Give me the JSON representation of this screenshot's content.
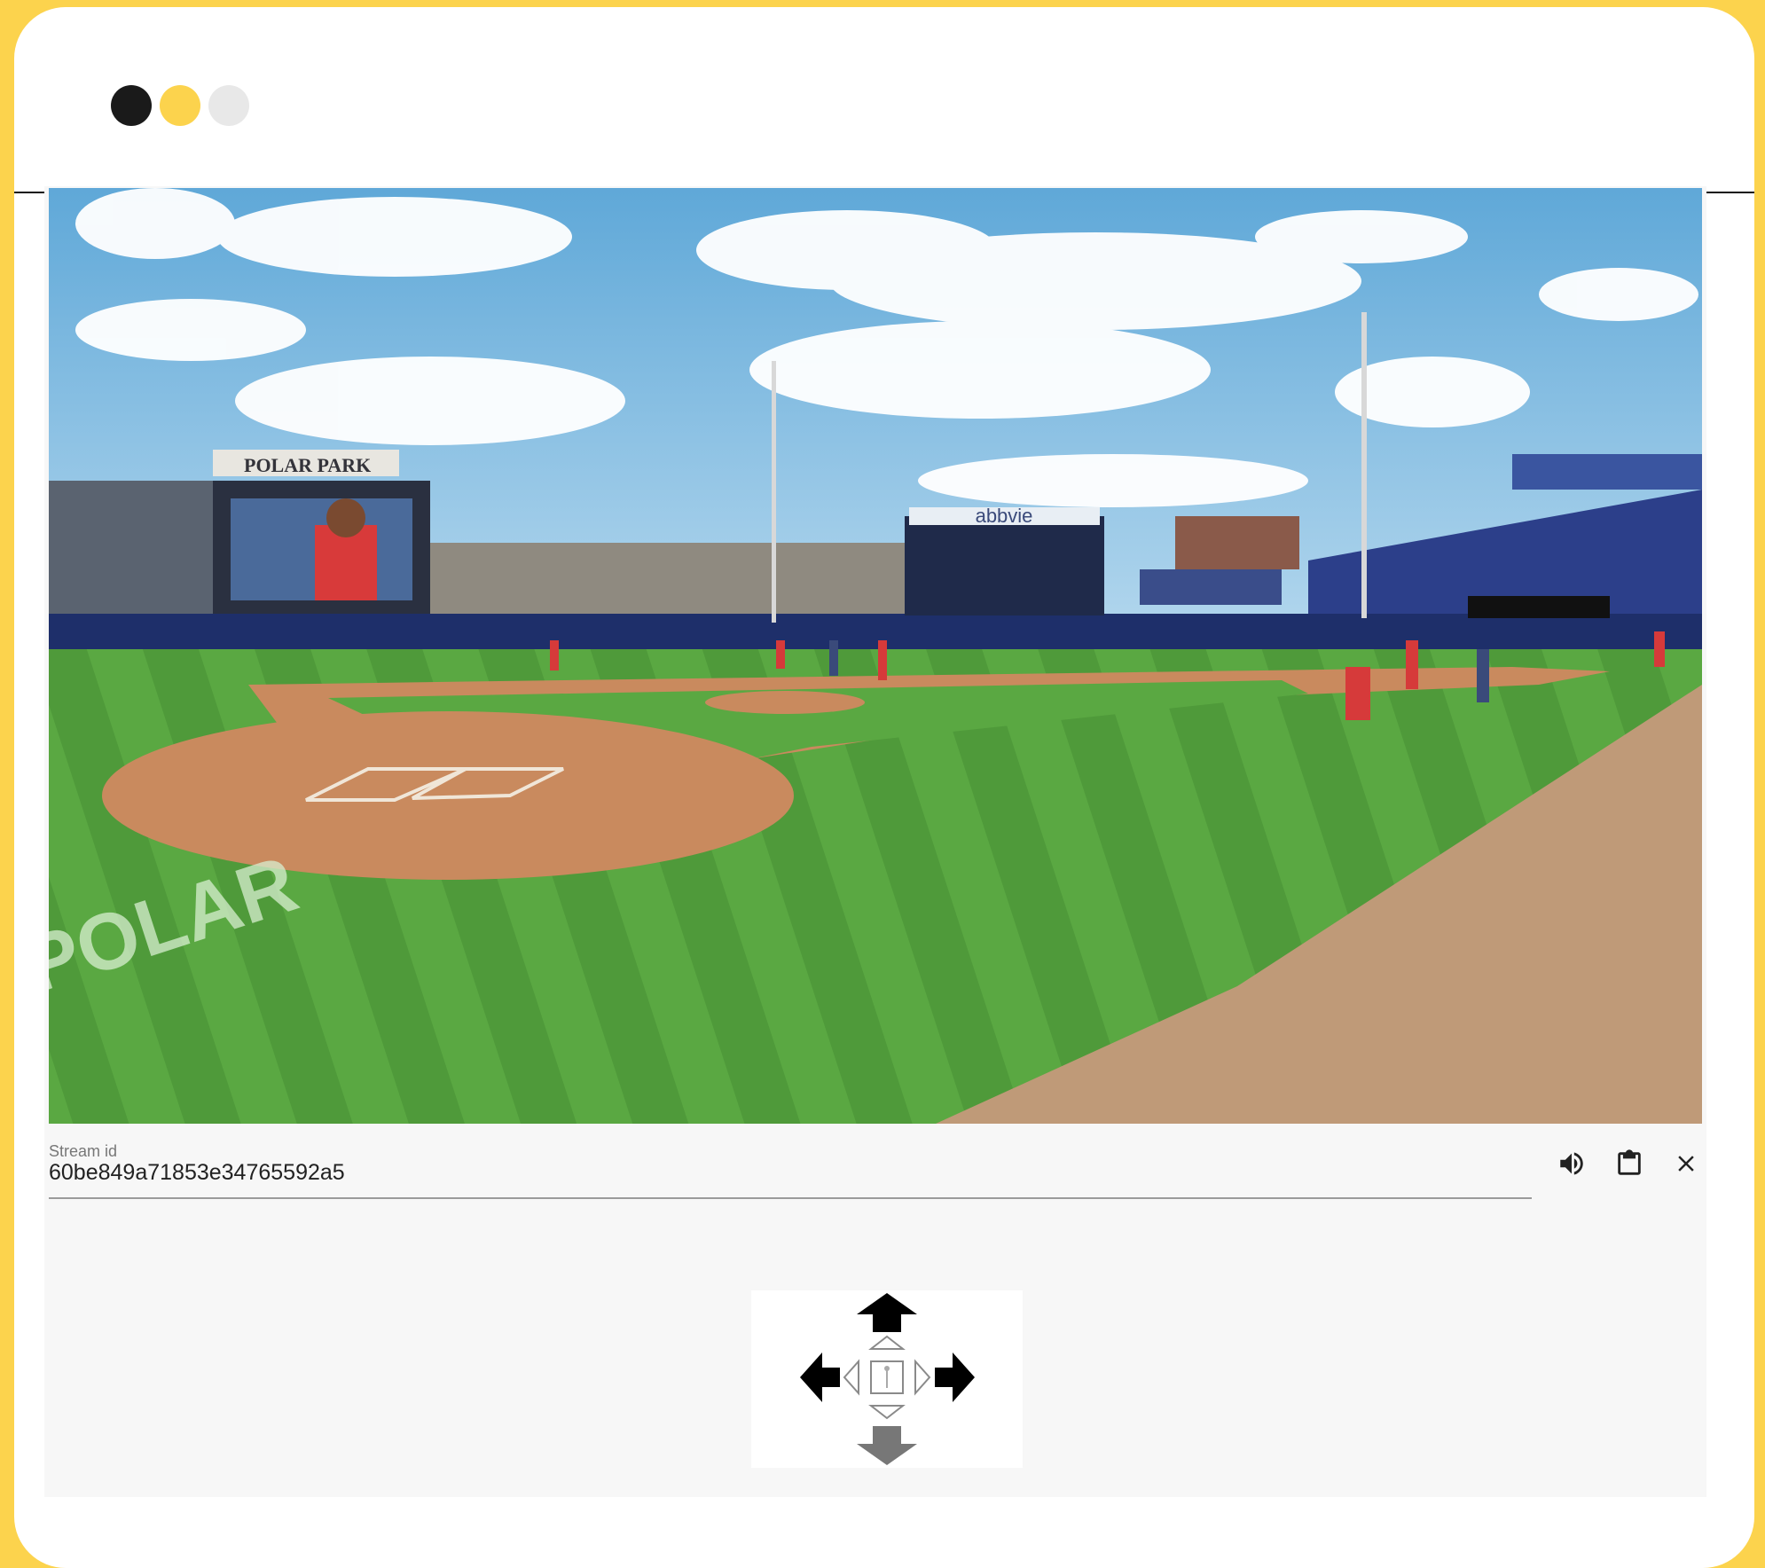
{
  "window": {
    "controls": [
      "black-dot",
      "yellow-dot",
      "gray-dot"
    ]
  },
  "video": {
    "stadium_sign": "POLAR PARK",
    "scoreboard_sign": "abbvie",
    "field_lettering": "POLAR"
  },
  "stream": {
    "label": "Stream id",
    "value": "60be849a71853e34765592a5"
  },
  "controls": {
    "icons": [
      "volume-icon",
      "clipboard-icon",
      "close-icon"
    ]
  },
  "dpad": {
    "icons": [
      "arrow-up-icon",
      "arrow-left-icon",
      "arrow-right-icon",
      "arrow-down-icon",
      "center-icon"
    ]
  }
}
